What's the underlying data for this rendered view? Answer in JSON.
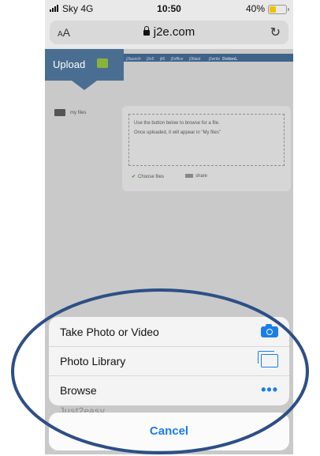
{
  "status_bar": {
    "carrier": "Sky",
    "network": "4G",
    "time": "10:50",
    "battery": "40%",
    "battery_fraction": 0.4
  },
  "url_bar": {
    "text_size_label": "AA",
    "domain": "j2e.com",
    "reload_icon": "reload-icon"
  },
  "page": {
    "upload_label": "Upload",
    "tabs": [
      "j2launch",
      "j2e5",
      "jit5",
      "j2office",
      "j2blast",
      "j2write"
    ],
    "tab_user": "DottonL",
    "my_files": "my files",
    "instructions_1": "Use the button below to browse for a file.",
    "instructions_2": "Once uploaded, it will appear in \"My files\"",
    "choose_files": "Choose files",
    "share": "share",
    "footer_partial": "Just2easy"
  },
  "action_sheet": {
    "items": [
      {
        "label": "Take Photo or Video",
        "icon": "camera-icon"
      },
      {
        "label": "Photo Library",
        "icon": "photo-library-icon"
      },
      {
        "label": "Browse",
        "icon": "more-dots-icon"
      }
    ],
    "cancel": "Cancel",
    "accent": "#1a7ee6"
  },
  "annotation": {
    "color": "#2d4f86"
  }
}
